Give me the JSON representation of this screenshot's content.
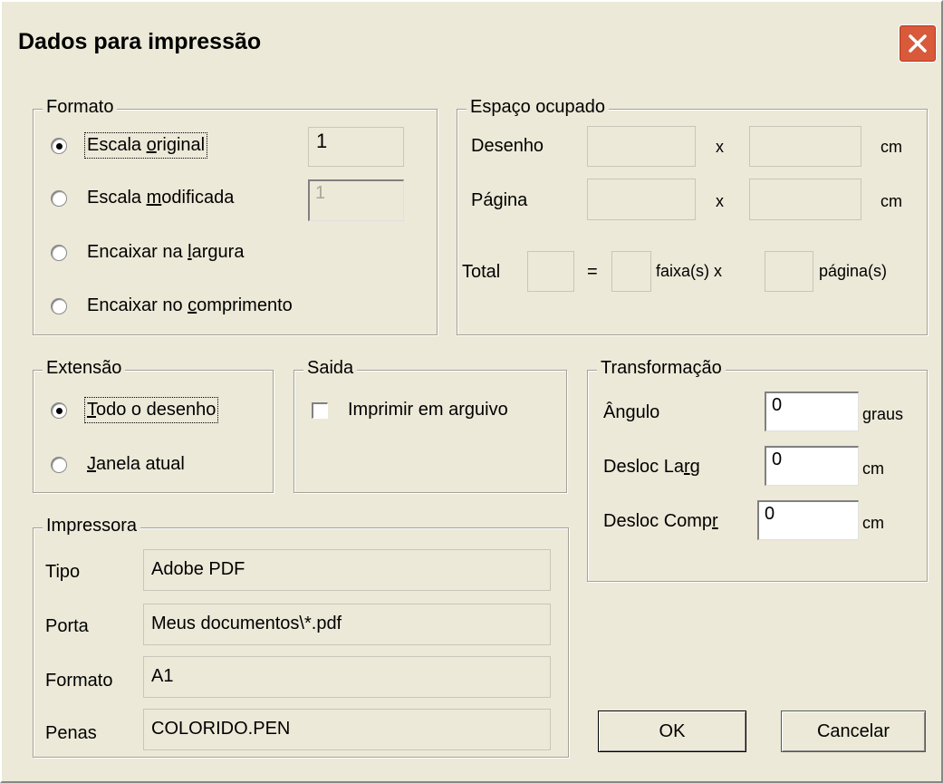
{
  "window": {
    "title": "Dados para impressão"
  },
  "formato": {
    "legend": "Formato",
    "options": [
      {
        "pre": "Escala ",
        "key": "o",
        "post": "riginal",
        "checked": true
      },
      {
        "pre": "Escala ",
        "key": "m",
        "post": "odificada",
        "checked": false
      },
      {
        "pre": "Encaixar na ",
        "key": "l",
        "post": "argura",
        "checked": false
      },
      {
        "pre": "Encaixar no ",
        "key": "c",
        "post": "omprimento",
        "checked": false
      }
    ],
    "scale_original_value": "1",
    "scale_modified_value": "1"
  },
  "espaco": {
    "legend": "Espaço ocupado",
    "desenho_label": "Desenho",
    "pagina_label": "Página",
    "x_label": "x",
    "unit": "cm",
    "total_label": "Total",
    "equals": "=",
    "faixas_label": "faixa(s) x",
    "paginas_label": "página(s)"
  },
  "extensao": {
    "legend": "Extensão",
    "options": [
      {
        "pre": "",
        "key": "T",
        "post": "odo o desenho",
        "checked": true
      },
      {
        "pre": "",
        "key": "J",
        "post": "anela atual",
        "checked": false
      }
    ]
  },
  "saida": {
    "legend": "Saida",
    "checkbox_label": "Imprimir em arguivo",
    "checked": false
  },
  "transformacao": {
    "legend": "Transformação",
    "angulo_label": "Ângulo",
    "angulo_value": "0",
    "angulo_unit": "graus",
    "larg_pre": "Desloc La",
    "larg_key": "r",
    "larg_post": "g",
    "larg_value": "0",
    "larg_unit": "cm",
    "compr_pre": "Desloc Comp",
    "compr_key": "r",
    "compr_value": "0",
    "compr_unit": "cm"
  },
  "impressora": {
    "legend": "Impressora",
    "tipo_label": "Tipo",
    "tipo_value": "Adobe PDF",
    "porta_label": "Porta",
    "porta_value": "Meus documentos\\*.pdf",
    "formato_label": "Formato",
    "formato_value": "A1",
    "penas_label": "Penas",
    "penas_value": "COLORIDO.PEN"
  },
  "buttons": {
    "ok": "OK",
    "cancel": "Cancelar"
  },
  "colors": {
    "close_button": "#d9593b",
    "dialog_bg": "#ece9d8"
  }
}
